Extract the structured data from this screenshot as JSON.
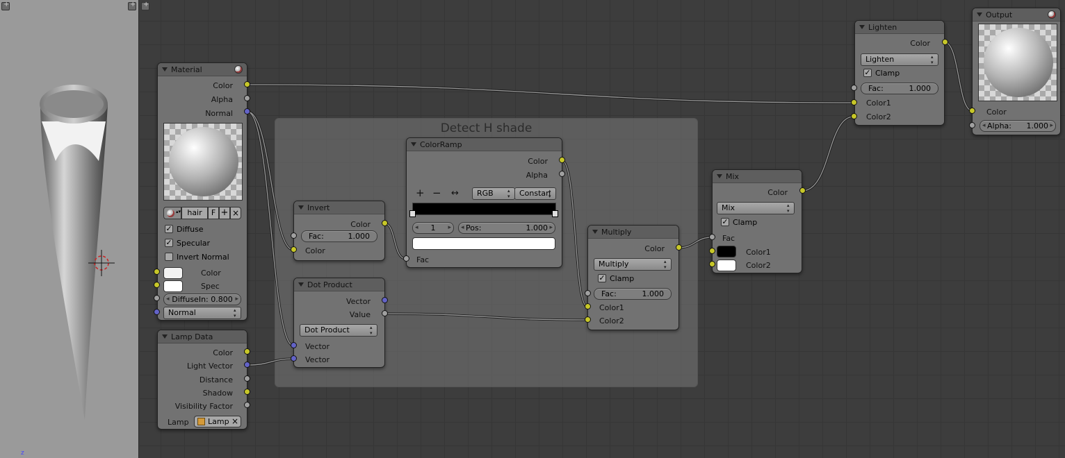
{
  "viewport": {
    "axis_label": "z"
  },
  "frame": {
    "label": "Detect H shade"
  },
  "material": {
    "title": "Material",
    "outputs": [
      "Color",
      "Alpha",
      "Normal"
    ],
    "material_name": "hair",
    "fake_user": "F",
    "checks": [
      {
        "label": "Diffuse",
        "checked": true
      },
      {
        "label": "Specular",
        "checked": true
      },
      {
        "label": "Invert Normal",
        "checked": false
      }
    ],
    "inputs": {
      "color": "Color",
      "spec": "Spec"
    },
    "diffuse": "DiffuseIn: 0.800",
    "normal": "Normal"
  },
  "lampdata": {
    "title": "Lamp Data",
    "outputs": [
      "Color",
      "Light Vector",
      "Distance",
      "Shadow",
      "Visibility Factor"
    ],
    "lamp_label": "Lamp",
    "lamp_value": "Lamp"
  },
  "invert": {
    "title": "Invert",
    "out": "Color",
    "fac_label": "Fac:",
    "fac_value": "1.000",
    "in": "Color"
  },
  "dot": {
    "title": "Dot Product",
    "outputs": [
      "Vector",
      "Value"
    ],
    "mode": "Dot Product",
    "inputs": [
      "Vector",
      "Vector"
    ]
  },
  "ramp": {
    "title": "ColorRamp",
    "outputs": [
      "Color",
      "Alpha"
    ],
    "tools": [
      "+",
      "−",
      "↔"
    ],
    "color_mode": "RGB",
    "interp": "Constan",
    "index": "1",
    "pos_label": "Pos:",
    "pos_value": "1.000",
    "in": "Fac"
  },
  "multiply": {
    "title": "Multiply",
    "out": "Color",
    "mode": "Multiply",
    "clamp": "Clamp",
    "fac_label": "Fac:",
    "fac_value": "1.000",
    "inputs": [
      "Color1",
      "Color2"
    ]
  },
  "mix": {
    "title": "Mix",
    "out": "Color",
    "mode": "Mix",
    "clamp": "Clamp",
    "inputs": [
      "Fac",
      "Color1",
      "Color2"
    ]
  },
  "lighten": {
    "title": "Lighten",
    "out": "Color",
    "mode": "Lighten",
    "clamp": "Clamp",
    "fac_label": "Fac:",
    "fac_value": "1.000",
    "inputs": [
      "Color1",
      "Color2"
    ]
  },
  "output": {
    "title": "Output",
    "in": "Color",
    "alpha_label": "Alpha:",
    "alpha_value": "1.000"
  },
  "colors": {
    "socket_color": "#c7c729",
    "socket_value": "#a0a0a0",
    "socket_vector": "#6363c7",
    "node_body": "#727272",
    "editor_bg": "#3d3d3d"
  }
}
